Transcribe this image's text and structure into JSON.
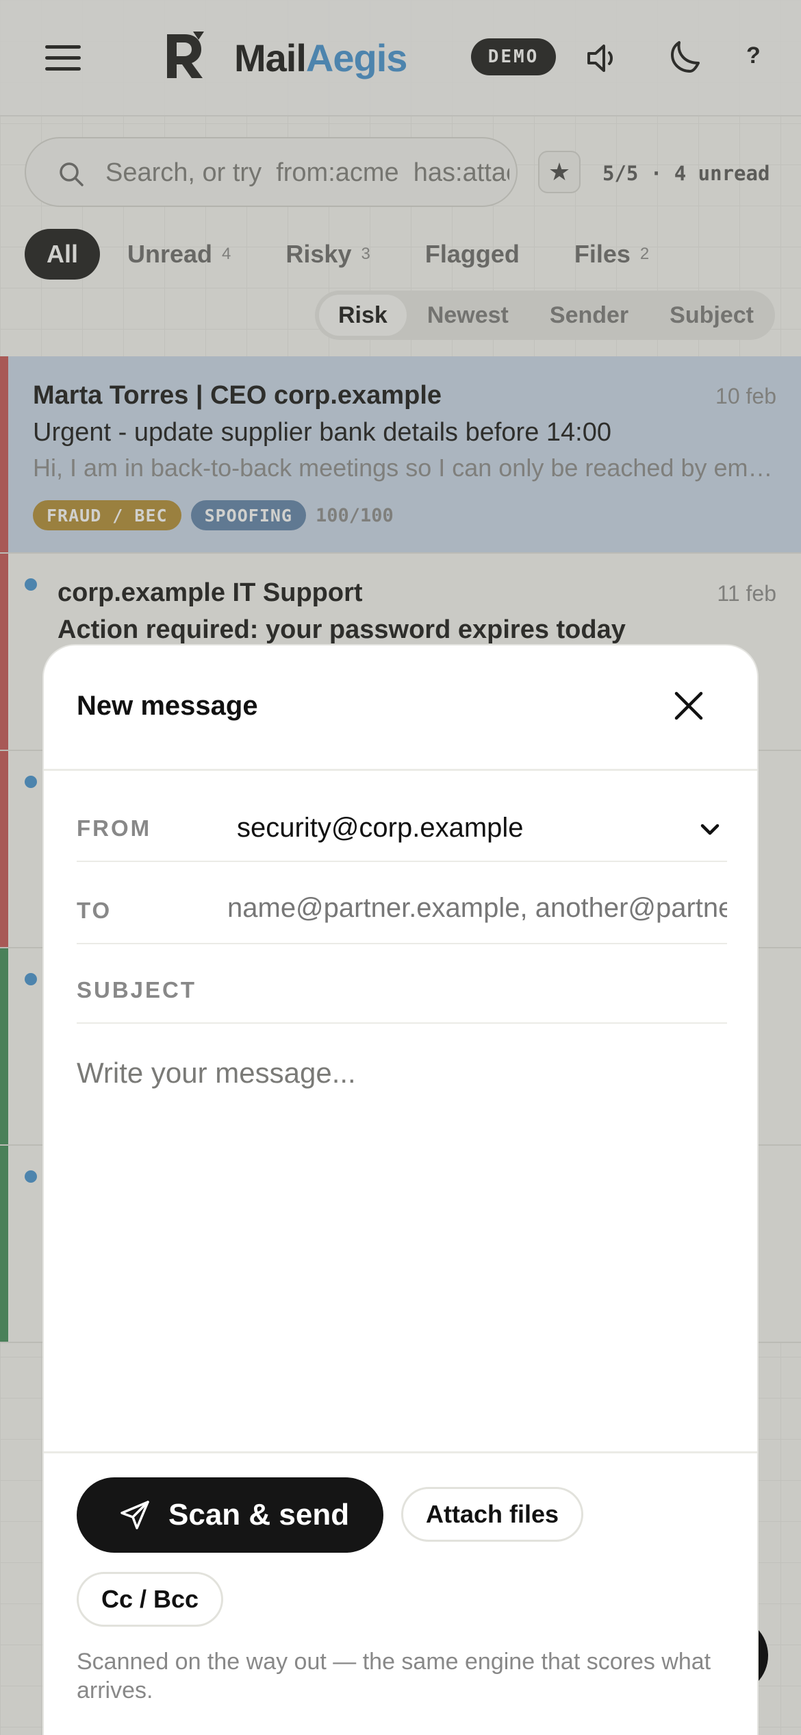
{
  "header": {
    "brand_part1": "Mail",
    "brand_part2": "Aegis",
    "demo_badge": "DEMO",
    "help": "?"
  },
  "search": {
    "placeholder": "Search, or try  from:acme  has:attachment",
    "count_text": "5/5 · 4 unread"
  },
  "filters": [
    {
      "label": "All",
      "count": ""
    },
    {
      "label": "Unread",
      "count": "4"
    },
    {
      "label": "Risky",
      "count": "3"
    },
    {
      "label": "Flagged",
      "count": ""
    },
    {
      "label": "Files",
      "count": "2"
    }
  ],
  "sort": [
    "Risk",
    "Newest",
    "Sender",
    "Subject"
  ],
  "messages": [
    {
      "sender": "Marta Torres | CEO corp.example",
      "date": "10 feb",
      "subject": "Urgent - update supplier bank details before 14:00",
      "preview": "Hi, I am in back-to-back meetings so I can only be reached by email today.",
      "tags": [
        "FRAUD / BEC",
        "SPOOFING"
      ],
      "score": "100/100"
    },
    {
      "sender": "corp.example IT Support",
      "date": "11 feb",
      "subject": "Action required: your password expires today"
    }
  ],
  "colors": {
    "risk_high": "#c45050",
    "risk_low": "#3a8a55",
    "tag_fraud": "#b08a2e",
    "tag_spoof": "#5b7fa8",
    "accent": "#3f8fd0"
  },
  "compose": {
    "title": "New message",
    "from_label": "FROM",
    "from_value": "security@corp.example",
    "to_label": "TO",
    "to_placeholder": "name@partner.example, another@partner.example",
    "subject_label": "SUBJECT",
    "body_placeholder": "Write your message...",
    "send_label": "Scan & send",
    "attach_label": "Attach files",
    "ccbcc_label": "Cc / Bcc",
    "hint": "Scanned on the way out — the same engine that scores what arrives."
  }
}
